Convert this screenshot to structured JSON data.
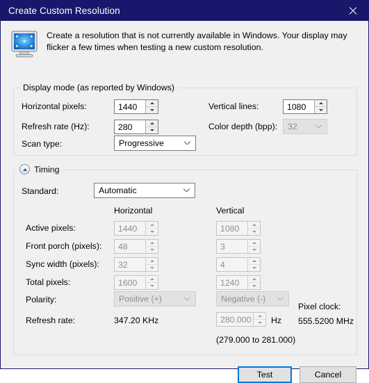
{
  "window": {
    "title": "Create Custom Resolution",
    "close_icon": "close-icon",
    "accent_color": "#17176b",
    "focus_color": "#0078d7",
    "background_color": "#f0f0f0"
  },
  "intro": {
    "icon": "monitor-icon",
    "text": "Create a resolution that is not currently available in Windows. Your display may flicker a few times when testing a new custom resolution."
  },
  "display_mode": {
    "legend": "Display mode (as reported by Windows)",
    "fields": {
      "horizontal_pixels": {
        "label": "Horizontal pixels:",
        "value": "1440",
        "enabled": true
      },
      "vertical_lines": {
        "label": "Vertical lines:",
        "value": "1080",
        "enabled": true
      },
      "refresh_rate": {
        "label": "Refresh rate (Hz):",
        "value": "280",
        "enabled": true
      },
      "color_depth": {
        "label": "Color depth (bpp):",
        "value": "32",
        "enabled": false
      },
      "scan_type": {
        "label": "Scan type:",
        "value": "Progressive",
        "enabled": true
      }
    }
  },
  "timing": {
    "legend": "Timing",
    "collapse_icon": "chevron-up-icon",
    "standard": {
      "label": "Standard:",
      "value": "Automatic",
      "enabled": true
    },
    "columns": {
      "horizontal": "Horizontal",
      "vertical": "Vertical"
    },
    "rows": [
      {
        "label": "Active pixels:",
        "horizontal": "1440",
        "vertical": "1080"
      },
      {
        "label": "Front porch (pixels):",
        "horizontal": "48",
        "vertical": "3"
      },
      {
        "label": "Sync width (pixels):",
        "horizontal": "32",
        "vertical": "4"
      },
      {
        "label": "Total pixels:",
        "horizontal": "1600",
        "vertical": "1240"
      }
    ],
    "polarity": {
      "label": "Polarity:",
      "horizontal": "Positive (+)",
      "vertical": "Negative (-)"
    },
    "refresh_rate": {
      "label": "Refresh rate:",
      "horizontal_value": "347.20 KHz",
      "vertical_value": "280.000",
      "vertical_unit": "Hz",
      "vertical_range": "(279.000 to 281.000)"
    },
    "pixel_clock": {
      "label": "Pixel clock:",
      "value": "555.5200 MHz"
    }
  },
  "footer": {
    "test_label": "Test",
    "cancel_label": "Cancel"
  }
}
